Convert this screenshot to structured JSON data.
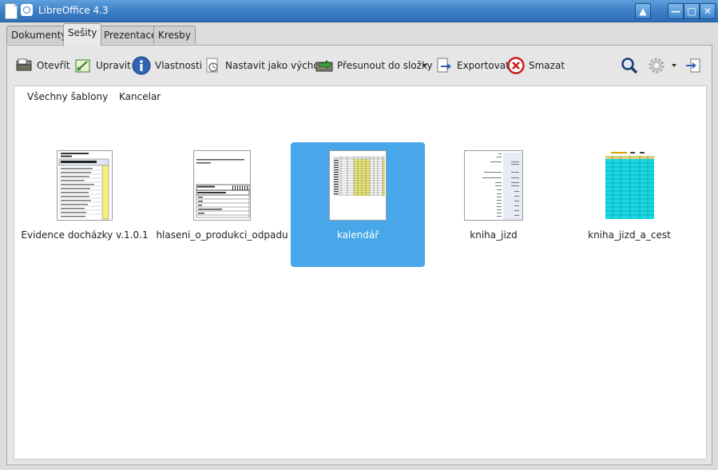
{
  "window": {
    "title": "LibreOffice 4.3",
    "controls": [
      "▲",
      "—",
      "□",
      "✕"
    ]
  },
  "tabs": [
    {
      "label": "Dokumenty",
      "active": false
    },
    {
      "label": "Sešity",
      "active": true
    },
    {
      "label": "Prezentace",
      "active": false
    },
    {
      "label": "Kresby",
      "active": false
    }
  ],
  "toolbar": {
    "open": "Otevřít",
    "edit": "Upravit",
    "properties": "Vlastnosti",
    "set_default": "Nastavit jako výchozí",
    "move": "Přesunout do složky",
    "export": "Exportovat",
    "delete": "Smazat"
  },
  "breadcrumb": [
    "Všechny šablony",
    "Kancelar"
  ],
  "templates": [
    {
      "name": "Evidence docházky v.1.0.1",
      "selected": false
    },
    {
      "name": "hlaseni_o_produkci_odpadu",
      "selected": false
    },
    {
      "name": "kalendář",
      "selected": true
    },
    {
      "name": "kniha_jizd",
      "selected": false
    },
    {
      "name": "kniha_jizd_a_cest",
      "selected": false
    }
  ],
  "colors": {
    "selection": "#47a7e8",
    "titlebar": "#3a7cc4",
    "highlight_yellow": "#f5f07a",
    "cyan": "#19d6e0"
  }
}
